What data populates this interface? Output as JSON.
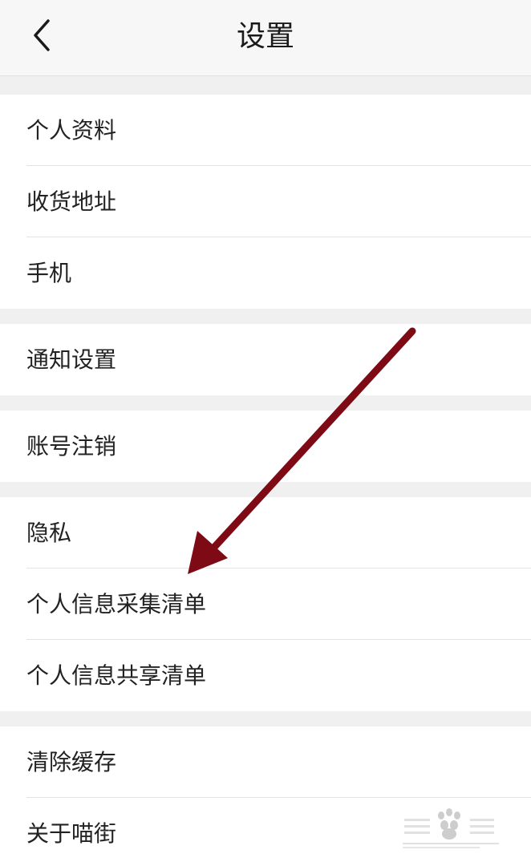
{
  "header": {
    "title": "设置",
    "back_icon": "chevron-left-icon"
  },
  "groups": [
    {
      "items": [
        {
          "label": "个人资料"
        },
        {
          "label": "收货地址"
        },
        {
          "label": "手机"
        }
      ]
    },
    {
      "items": [
        {
          "label": "通知设置"
        }
      ]
    },
    {
      "items": [
        {
          "label": "账号注销"
        }
      ]
    },
    {
      "items": [
        {
          "label": "隐私"
        },
        {
          "label": "个人信息采集清单"
        },
        {
          "label": "个人信息共享清单"
        }
      ]
    },
    {
      "items": [
        {
          "label": "清除缓存"
        },
        {
          "label": "关于喵街"
        }
      ]
    }
  ],
  "annotation": {
    "icon": "arrow-annotation-icon",
    "color": "#7d0a14"
  },
  "watermark": {
    "icon": "baidu-jingyan-watermark-icon",
    "color": "#bdbdbd"
  },
  "colors": {
    "page_background": "#f0f0f0",
    "row_background": "#ffffff",
    "text": "#222222",
    "divider": "#e4e4e4"
  }
}
